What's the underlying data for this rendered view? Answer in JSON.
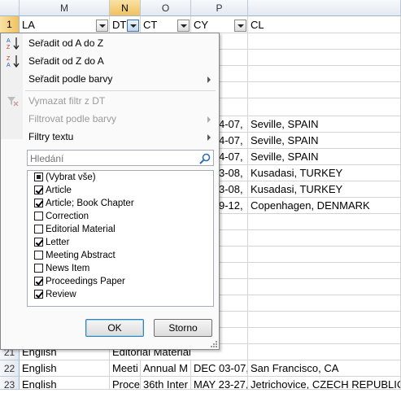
{
  "columns": [
    {
      "id": "M",
      "header": "LA"
    },
    {
      "id": "N",
      "header": "DT"
    },
    {
      "id": "O",
      "header": "CT"
    },
    {
      "id": "P",
      "header": "CY"
    },
    {
      "id": "Q",
      "header": "CL"
    }
  ],
  "row_numbers": [
    "1",
    "21",
    "22",
    "23"
  ],
  "rows_visible": [
    {
      "row": "21",
      "LA": "English",
      "DT": "Editorial Material",
      "CT": "",
      "CY": "",
      "CL": ""
    },
    {
      "row": "22",
      "LA": "English",
      "DT": "Meeti",
      "CT": "Annual M",
      "CY": "DEC 03-07,",
      "CL": "San Francisco, CA"
    },
    {
      "row": "23",
      "LA": "English",
      "DT": "Proce",
      "CT": "36th Inter",
      "CY": "MAY 23-27,",
      "CL": "Jetrichovice, CZECH REPUBLIC"
    }
  ],
  "partial_rows": [
    {
      "CY": "4-07,",
      "CL": "Seville, SPAIN"
    },
    {
      "CY": "4-07,",
      "CL": "Seville, SPAIN"
    },
    {
      "CY": "4-07,",
      "CL": "Seville, SPAIN"
    },
    {
      "CY": "3-08,",
      "CL": "Kusadasi, TURKEY"
    },
    {
      "CY": "3-08,",
      "CL": "Kusadasi, TURKEY"
    },
    {
      "CY": "9-12,",
      "CL": "Copenhagen, DENMARK"
    }
  ],
  "menu": {
    "sort_asc": "Seřadit od A do Z",
    "sort_desc": "Seřadit od Z do A",
    "sort_color": "Seřadit podle barvy",
    "clear_filter": "Vymazat filtr z DT",
    "filter_color": "Filtrovat podle barvy",
    "text_filters": "Filtry textu",
    "search_placeholder": "Hledání",
    "ok": "OK",
    "cancel": "Storno"
  },
  "filter_items": [
    {
      "label": "(Vybrat vše)",
      "state": "partial"
    },
    {
      "label": "Article",
      "state": "checked"
    },
    {
      "label": "Article; Book Chapter",
      "state": "checked"
    },
    {
      "label": "Correction",
      "state": "unchecked"
    },
    {
      "label": "Editorial Material",
      "state": "unchecked"
    },
    {
      "label": "Letter",
      "state": "checked"
    },
    {
      "label": "Meeting Abstract",
      "state": "unchecked"
    },
    {
      "label": "News Item",
      "state": "unchecked"
    },
    {
      "label": "Proceedings Paper",
      "state": "checked"
    },
    {
      "label": "Review",
      "state": "checked"
    }
  ]
}
